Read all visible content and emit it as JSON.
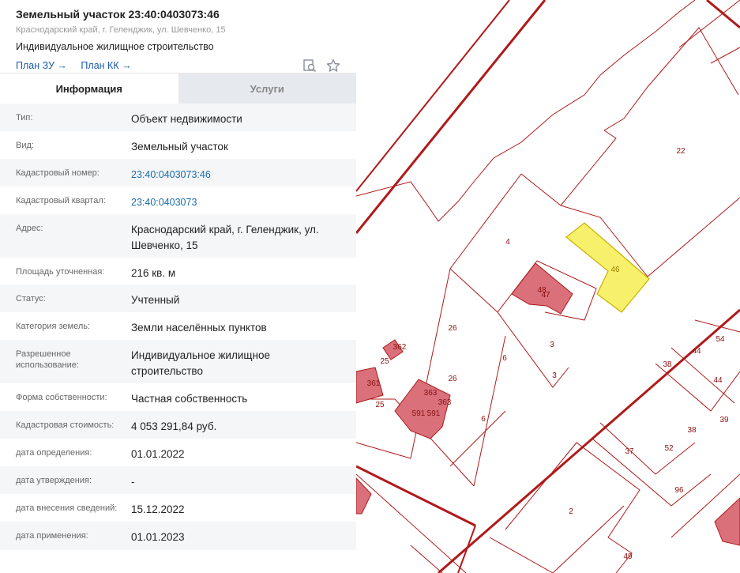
{
  "header": {
    "title": "Земельный участок 23:40:0403073:46",
    "address": "Краснодарский край, г. Геленджик, ул. Шевченко, 15",
    "use": "Индивидуальное жилищное строительство",
    "link_plan_zu": "План ЗУ →",
    "link_plan_kk": "План КК →",
    "icons": [
      "search-map-icon",
      "star-icon"
    ]
  },
  "tabs": {
    "info": "Информация",
    "services": "Услуги"
  },
  "rows": [
    {
      "k": "Тип:",
      "v": "Объект недвижимости"
    },
    {
      "k": "Вид:",
      "v": "Земельный участок"
    },
    {
      "k": "Кадастровый номер:",
      "v": "23:40:0403073:46"
    },
    {
      "k": "Кадастровый квартал:",
      "v": "23:40:0403073"
    },
    {
      "k": "Адрес:",
      "v": "Краснодарский край, г. Геленджик, ул. Шевченко, 15"
    },
    {
      "k": "Площадь уточненная:",
      "v": "216 кв. м"
    },
    {
      "k": "Статус:",
      "v": "Учтенный"
    },
    {
      "k": "Категория земель:",
      "v": "Земли населённых пунктов"
    },
    {
      "k": "Разрешенное использование:",
      "v": "Индивидуальное жилищное строительство"
    },
    {
      "k": "Форма собственности:",
      "v": "Частная собственность"
    },
    {
      "k": "Кадастровая стоимость:",
      "v": "4 053 291,84 руб."
    },
    {
      "k": "дата определения:",
      "v": "01.01.2022"
    },
    {
      "k": "дата утверждения:",
      "v": "-"
    },
    {
      "k": "дата внесения сведений:",
      "v": "15.12.2022"
    },
    {
      "k": "дата применения:",
      "v": "01.01.2023"
    }
  ],
  "map": {
    "labels": [
      "22",
      "4",
      "46",
      "48",
      "47",
      "26",
      "3",
      "6",
      "3",
      "26",
      "6",
      "362",
      "25",
      "361",
      "25",
      "363",
      "363",
      "591",
      "591",
      "44",
      "54",
      "38",
      "44",
      "39",
      "38",
      "37",
      "52",
      "96",
      "2",
      "49"
    ],
    "colors": {
      "boundary": "#b01a1a",
      "building": "#d9707a",
      "selected": "#f7f06a"
    }
  }
}
